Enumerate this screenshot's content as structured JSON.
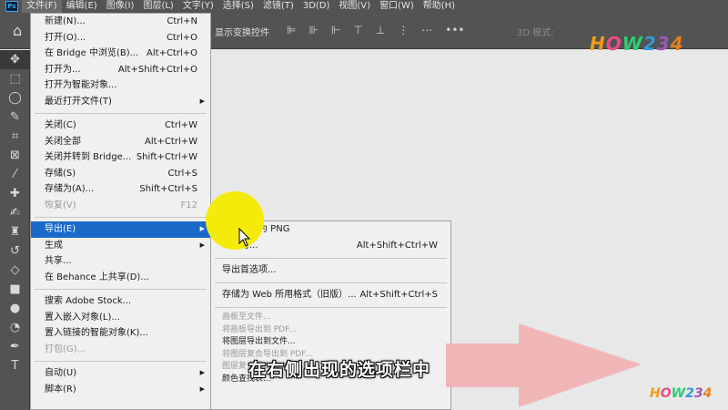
{
  "app": {
    "logo": "Ps"
  },
  "menubar": [
    {
      "label": "文件(F)",
      "active": true
    },
    {
      "label": "编辑(E)"
    },
    {
      "label": "图像(I)"
    },
    {
      "label": "图层(L)"
    },
    {
      "label": "文字(Y)"
    },
    {
      "label": "选择(S)"
    },
    {
      "label": "滤镜(T)"
    },
    {
      "label": "3D(D)"
    },
    {
      "label": "视图(V)"
    },
    {
      "label": "窗口(W)"
    },
    {
      "label": "帮助(H)"
    }
  ],
  "options": {
    "show_transform": "显示变换控件",
    "mode_3d": "3D 模式:"
  },
  "file_menu": [
    {
      "label": "新建(N)...",
      "shortcut": "Ctrl+N"
    },
    {
      "label": "打开(O)...",
      "shortcut": "Ctrl+O"
    },
    {
      "label": "在 Bridge 中浏览(B)...",
      "shortcut": "Alt+Ctrl+O"
    },
    {
      "label": "打开为...",
      "shortcut": "Alt+Shift+Ctrl+O"
    },
    {
      "label": "打开为智能对象..."
    },
    {
      "label": "最近打开文件(T)",
      "arrow": true
    },
    {
      "sep": true
    },
    {
      "label": "关闭(C)",
      "shortcut": "Ctrl+W"
    },
    {
      "label": "关闭全部",
      "shortcut": "Alt+Ctrl+W"
    },
    {
      "label": "关闭并转到 Bridge...",
      "shortcut": "Shift+Ctrl+W"
    },
    {
      "label": "存储(S)",
      "shortcut": "Ctrl+S"
    },
    {
      "label": "存储为(A)...",
      "shortcut": "Shift+Ctrl+S"
    },
    {
      "label": "恢复(V)",
      "shortcut": "F12",
      "disabled": true
    },
    {
      "sep": true
    },
    {
      "label": "导出(E)",
      "arrow": true,
      "highlight": true
    },
    {
      "label": "生成",
      "arrow": true
    },
    {
      "label": "共享..."
    },
    {
      "label": "在 Behance 上共享(D)..."
    },
    {
      "sep": true
    },
    {
      "label": "搜索 Adobe Stock..."
    },
    {
      "label": "置入嵌入对象(L)..."
    },
    {
      "label": "置入链接的智能对象(K)..."
    },
    {
      "label": "打包(G)...",
      "disabled": true
    },
    {
      "sep": true
    },
    {
      "label": "自动(U)",
      "arrow": true
    },
    {
      "label": "脚本(R)",
      "arrow": true
    }
  ],
  "export_submenu": [
    {
      "label": "快速导出为 PNG"
    },
    {
      "label": "导出为...",
      "shortcut": "Alt+Shift+Ctrl+W"
    },
    {
      "sep": true
    },
    {
      "label": "导出首选项..."
    },
    {
      "sep": true
    },
    {
      "label": "存储为 Web 所用格式（旧版）...",
      "shortcut": "Alt+Shift+Ctrl+S"
    },
    {
      "sep": true
    },
    {
      "label": "画板至文件...",
      "disabled": true,
      "small": true
    },
    {
      "label": "将画板导出到 PDF...",
      "disabled": true,
      "small": true
    },
    {
      "label": "将图层导出到文件...",
      "small": true
    },
    {
      "label": "将图层复合导出到 PDF...",
      "disabled": true,
      "small": true
    },
    {
      "label": "图层复合导出到文件...",
      "disabled": true,
      "small": true
    },
    {
      "label": "颜色查找表...",
      "small": true
    }
  ],
  "subtitle": "在右侧出现的选项栏中",
  "watermark": [
    "H",
    "O",
    "W",
    "2",
    "3",
    "4"
  ],
  "colors": {
    "highlight": "#1b6ac9",
    "cursor_spot": "#f5eb0a",
    "arrow": "#f1b6b8"
  }
}
